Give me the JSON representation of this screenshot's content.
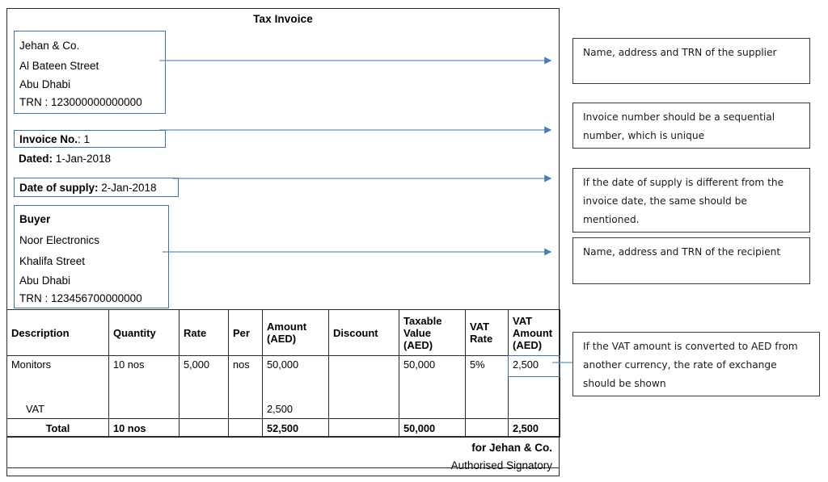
{
  "invoice": {
    "title": "Tax Invoice",
    "supplier": {
      "name": "Jehan & Co.",
      "street": "Al Bateen Street",
      "city": "Abu Dhabi",
      "trn": "TRN : 123000000000000"
    },
    "invoice_no_label": "Invoice No.",
    "invoice_no_value": ": 1",
    "dated_label": "Dated:",
    "dated_value": " 1-Jan-2018",
    "supply_date_label": "Date of supply:",
    "supply_date_value": " 2-Jan-2018",
    "buyer": {
      "heading": "Buyer",
      "name": "Noor Electronics",
      "street": "Khalifa Street",
      "city": "Abu Dhabi",
      "trn": "TRN : 123456700000000"
    },
    "table": {
      "headers": [
        "Description",
        "Quantity",
        "Rate",
        "Per",
        "Amount (AED)",
        "Discount",
        "Taxable Value (AED)",
        "VAT Rate",
        "VAT Amount (AED)"
      ],
      "rows": [
        {
          "description": "Monitors",
          "quantity": "10 nos",
          "rate": "5,000",
          "per": "nos",
          "amount": "50,000",
          "discount": "",
          "taxable_value": "50,000",
          "vat_rate": "5%",
          "vat_amount": "2,500",
          "sub_label": "VAT",
          "sub_amount": "2,500"
        }
      ],
      "total": {
        "label": "Total",
        "quantity": "10 nos",
        "rate": "",
        "per": "",
        "amount": "52,500",
        "discount": "",
        "taxable_value": "50,000",
        "vat_rate": "",
        "vat_amount": "2,500"
      }
    },
    "footer": {
      "for_line": "for Jehan & Co.",
      "authorised": "Authorised Signatory"
    }
  },
  "callouts": {
    "supplier": "Name, address and TRN of the supplier",
    "invoice_number": "Invoice number should be a sequential number, which is unique",
    "supply_date": "If the date of supply is different from the invoice date, the same should be mentioned.",
    "recipient": "Name, address and TRN of the recipient",
    "vat_exchange": "If the VAT amount is converted to AED from another currency, the rate of exchange should be shown"
  },
  "colors": {
    "highlight_border": "#3f6FA8",
    "connector_line": "#5b8fc4",
    "arrow_head": "#4A7EBB",
    "frame_border": "#2b2b2b",
    "callout_border": "#3a3a3a"
  }
}
